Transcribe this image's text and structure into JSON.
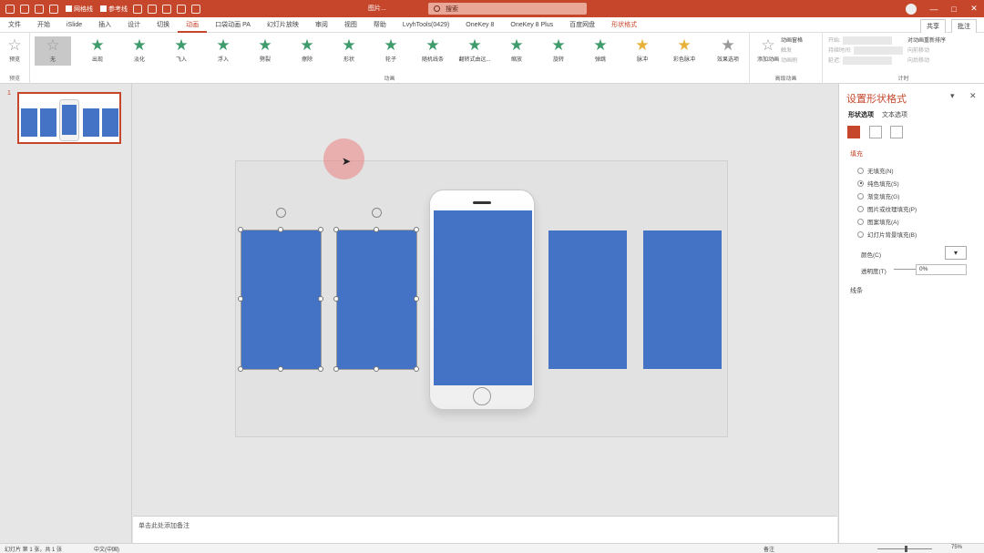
{
  "titlebar": {
    "checkboxes": [
      "网格线",
      "参考线"
    ],
    "document": "图片...",
    "search_placeholder": "搜索",
    "buttons": [
      "—",
      "□",
      "✕"
    ]
  },
  "tabs": [
    "文件",
    "开始",
    "iSlide",
    "插入",
    "设计",
    "切换",
    "动画",
    "口袋动画 PA",
    "幻灯片放映",
    "审阅",
    "视图",
    "帮助",
    "LvyhTools(0429)",
    "OneKey 8",
    "OneKey 8 Plus",
    "百度网盘",
    "形状格式"
  ],
  "active_tab": "动画",
  "share": "共享",
  "comments": "批注",
  "ribbon": {
    "preview": {
      "button": "预览",
      "group": "预览"
    },
    "animations": [
      "无",
      "出现",
      "淡化",
      "飞入",
      "浮入",
      "劈裂",
      "擦除",
      "形状",
      "轮子",
      "随机线条",
      "翻转式由远...",
      "缩放",
      "旋转",
      "弹跳",
      "脉冲",
      "彩色脉冲"
    ],
    "effect_options": "效果选项",
    "animation_group": "动画",
    "advanced": {
      "add": "添加动画",
      "pane": "动画窗格",
      "trigger": "触发",
      "painter": "动画刷",
      "group": "高级动画"
    },
    "timing": {
      "start": "开始:",
      "duration": "持续时间:",
      "delay": "延迟:",
      "reorder": "对动画重新排序",
      "earlier": "向前移动",
      "later": "向后移动",
      "group": "计时"
    }
  },
  "thumbnails": {
    "slide_number": "1"
  },
  "notes": "单击此处添加备注",
  "format_pane": {
    "title": "设置形状格式",
    "tabs": [
      "形状选项",
      "文本选项"
    ],
    "fill_header": "填充",
    "fill_options": [
      "无填充(N)",
      "纯色填充(S)",
      "渐变填充(G)",
      "图片或纹理填充(P)",
      "图案填充(A)",
      "幻灯片背景填充(B)"
    ],
    "selected_fill": "纯色填充(S)",
    "color_label": "颜色(C)",
    "transparency_label": "透明度(T)",
    "transparency_value": "0%",
    "border_header": "线条"
  },
  "statusbar": {
    "slide_info": "幻灯片 第 1 张，共 1 张",
    "language": "中文(中国)",
    "notes_btn": "备注",
    "zoom": "75%"
  },
  "colors": {
    "accent": "#c5462a",
    "shape_fill": "#4472c4",
    "animation_star": "#3f9b6b"
  }
}
